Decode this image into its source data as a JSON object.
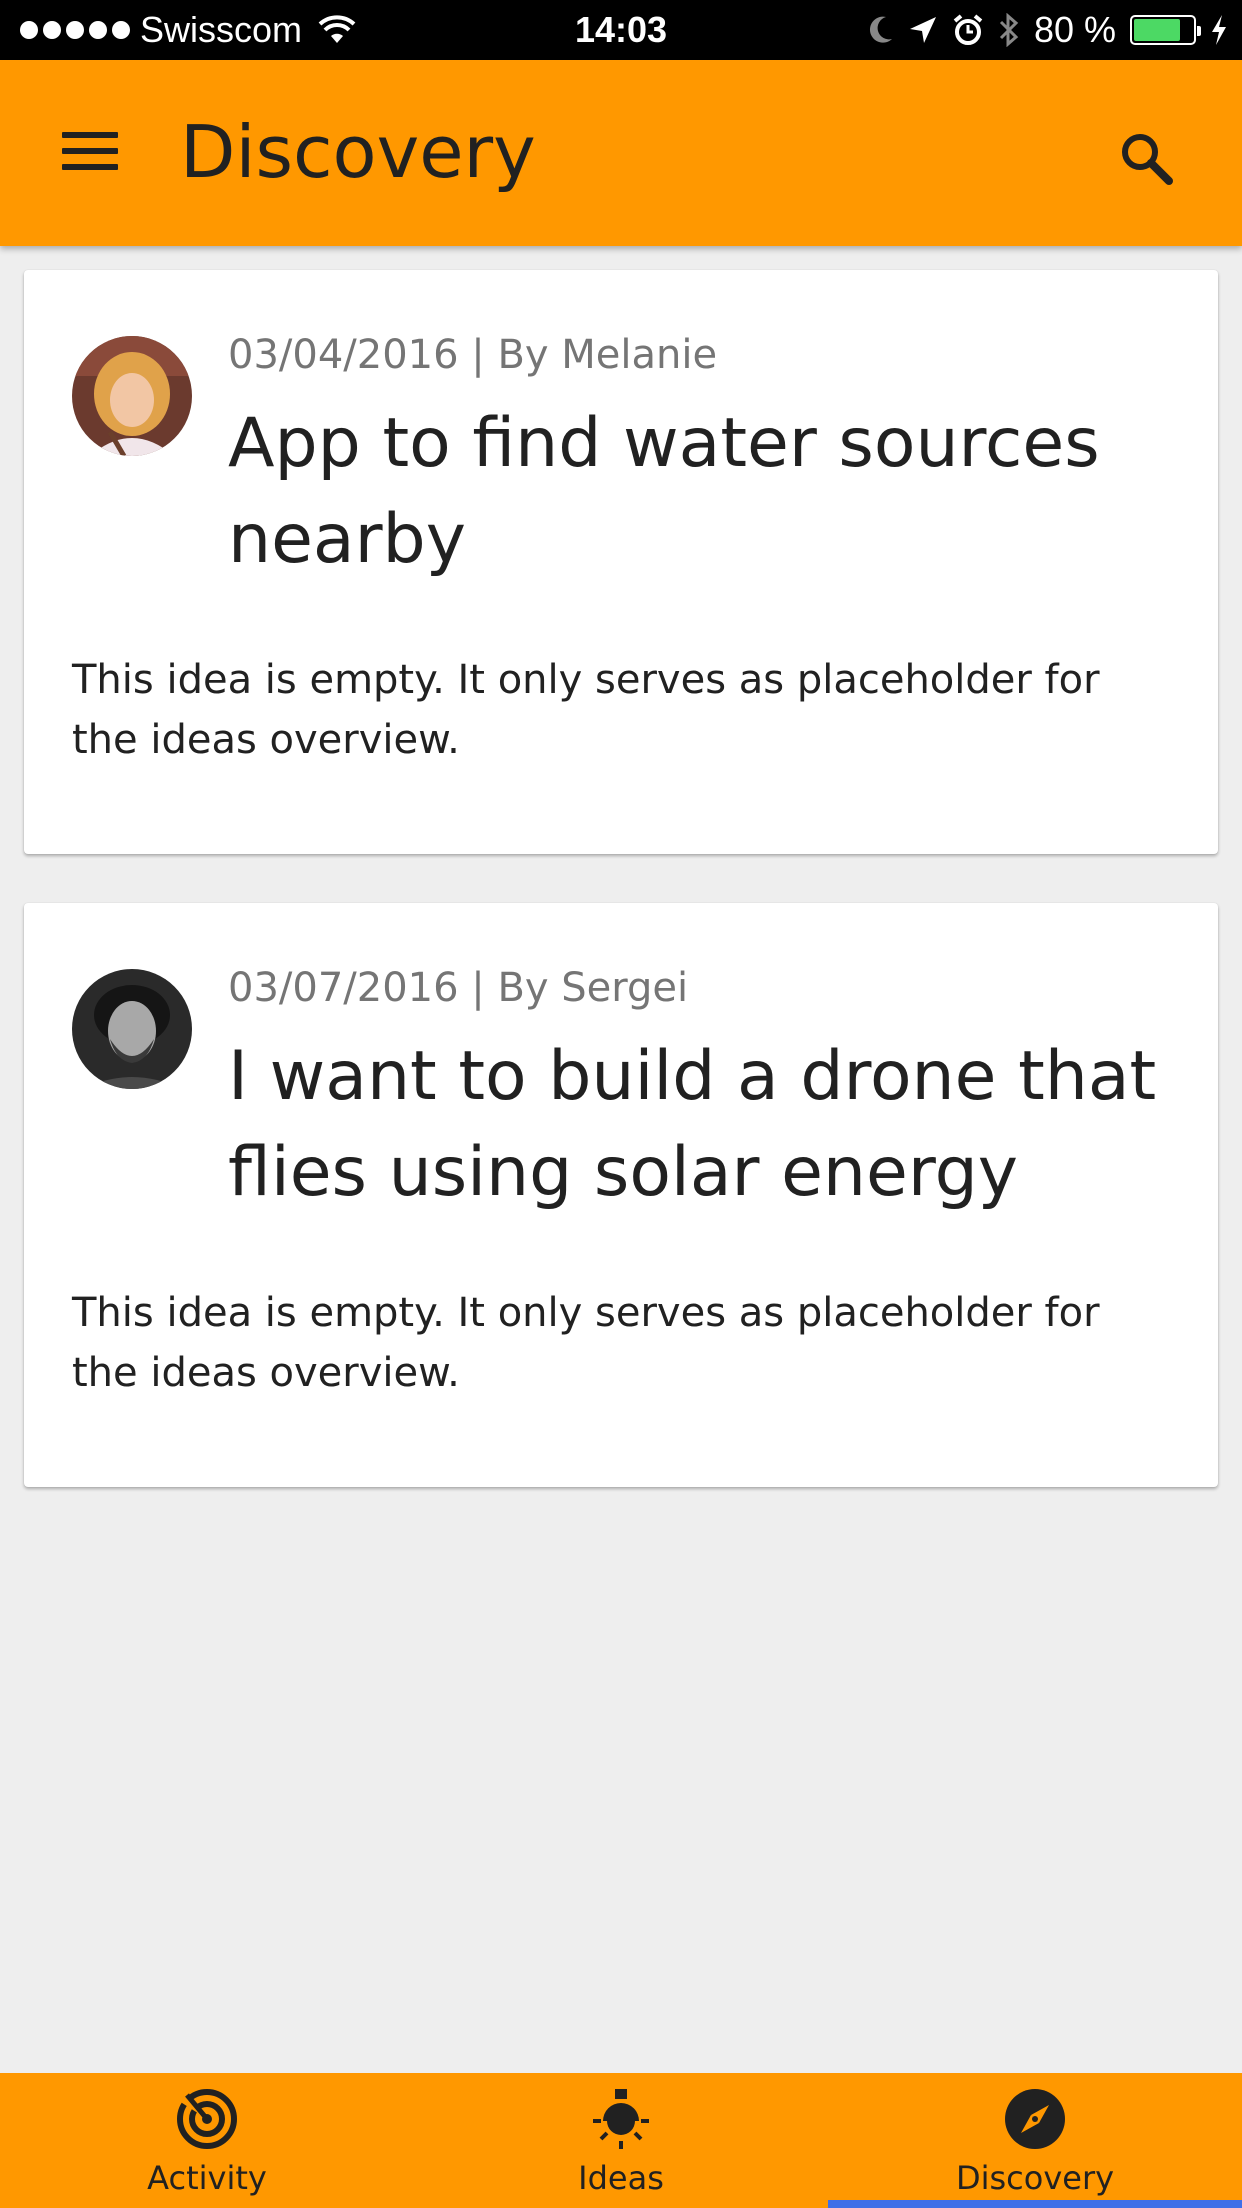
{
  "status_bar": {
    "carrier": "Swisscom",
    "time": "14:03",
    "battery_percent": "80 %",
    "battery_level": 0.8,
    "battery_color": "#4cd964"
  },
  "app_bar": {
    "title": "Discovery",
    "menu_icon": "hamburger-menu-icon",
    "search_icon": "search-icon",
    "background": "#ff9800"
  },
  "cards": [
    {
      "meta": "03/04/2016 | By Melanie",
      "title": "App to find water sources nearby",
      "body": "This idea is empty. It only serves as placeholder for the ideas overview."
    },
    {
      "meta": "03/07/2016 | By Sergei",
      "title": "I want to build a drone that flies using solar energy",
      "body": "This idea is empty. It only serves as placeholder for the ideas overview."
    }
  ],
  "bottom_nav": {
    "items": [
      {
        "label": "Activity",
        "icon": "activity-radar-icon",
        "active": false
      },
      {
        "label": "Ideas",
        "icon": "lightbulb-icon",
        "active": false
      },
      {
        "label": "Discovery",
        "icon": "compass-icon",
        "active": true
      }
    ],
    "active_indicator_color": "#3f6fe8"
  }
}
